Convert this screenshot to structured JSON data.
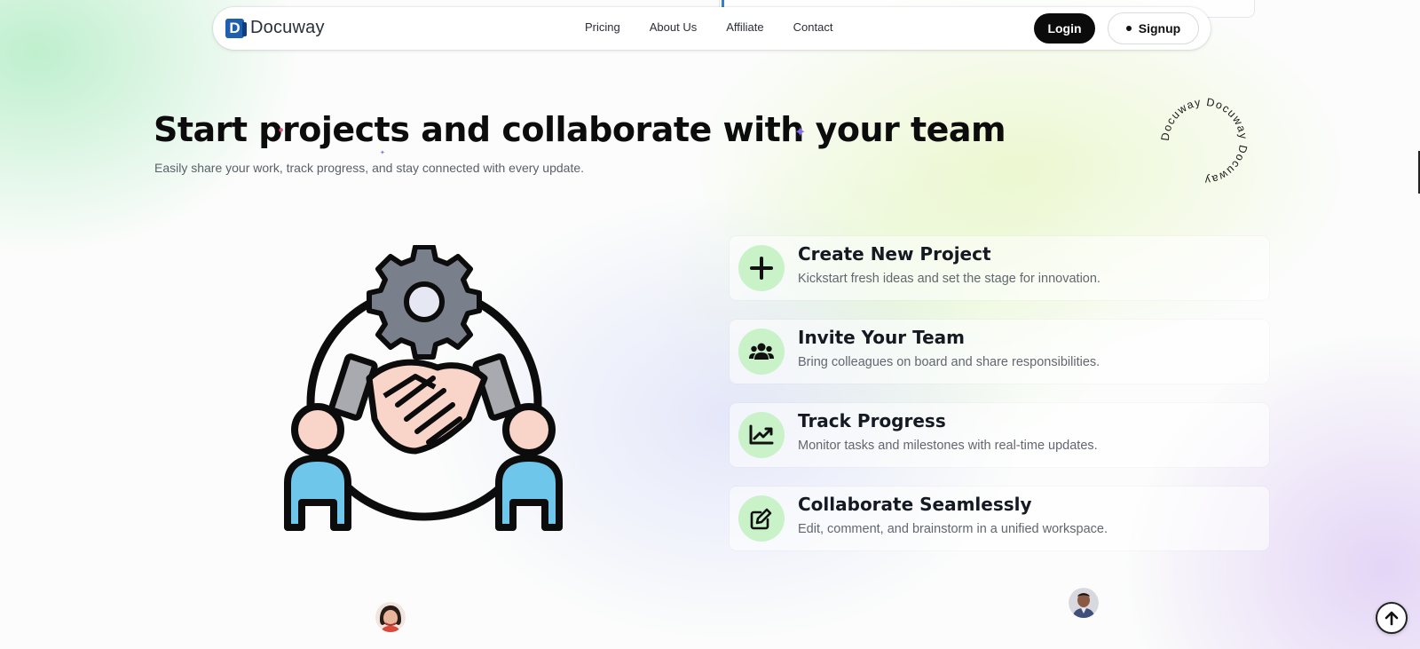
{
  "brand": {
    "name": "Docuway",
    "mark": "D"
  },
  "nav": {
    "links": [
      "Pricing",
      "About Us",
      "Affiliate",
      "Contact"
    ],
    "login": "Login",
    "signup": "Signup"
  },
  "hero": {
    "title": "Start projects and collaborate with your team",
    "subtitle": "Easily share your work, track progress, and stay connected with every update."
  },
  "badge": {
    "text": "Docuway Docuway Docuway"
  },
  "features": [
    {
      "icon": "plus-icon",
      "title": "Create New Project",
      "desc": "Kickstart fresh ideas and set the stage for innovation."
    },
    {
      "icon": "users-icon",
      "title": "Invite Your Team",
      "desc": "Bring colleagues on board and share responsibilities."
    },
    {
      "icon": "chart-line-icon",
      "title": "Track Progress",
      "desc": "Monitor tasks and milestones with real-time updates."
    },
    {
      "icon": "edit-icon",
      "title": "Collaborate Seamlessly",
      "desc": "Edit, comment, and brainstorm in a unified workspace."
    }
  ],
  "colors": {
    "accent_green": "#c9f2c9",
    "brand_blue": "#1f5fb0",
    "dark": "#0b0b0b"
  }
}
